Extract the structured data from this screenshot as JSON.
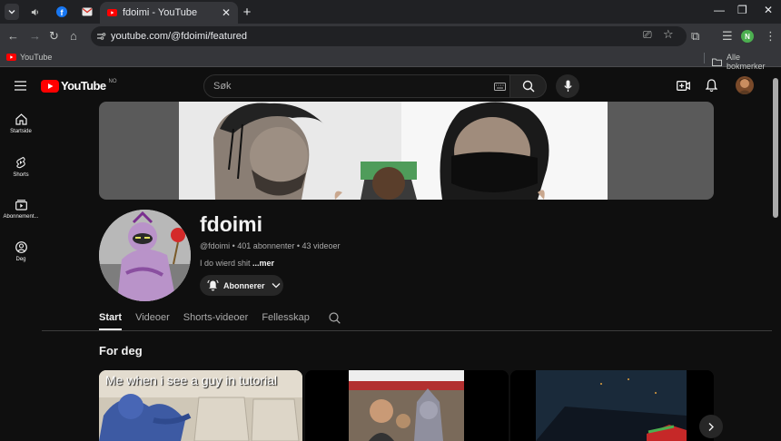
{
  "browser": {
    "active_tab_title": "fdoimi - YouTube",
    "url": "youtube.com/@fdoimi/featured",
    "bookmark_youtube": "YouTube",
    "bookmark_all": "Alle bokmerker",
    "profile_letter": "N"
  },
  "youtube": {
    "logo_text": "YouTube",
    "region": "NO",
    "search_placeholder": "Søk"
  },
  "sidebar": {
    "items": [
      {
        "label": "Startside",
        "icon": "home-icon"
      },
      {
        "label": "Shorts",
        "icon": "shorts-icon"
      },
      {
        "label": "Abonnement...",
        "icon": "subscriptions-icon"
      },
      {
        "label": "Deg",
        "icon": "user-icon"
      }
    ]
  },
  "channel": {
    "name": "fdoimi",
    "handle_line": "@fdoimi • 401 abonnenter • 43 videoer",
    "description": "I do wierd shit",
    "more": "...mer",
    "subscribe_label": "Abonnerer"
  },
  "tabs": [
    "Start",
    "Videoer",
    "Shorts-videoer",
    "Fellesskap"
  ],
  "section": {
    "title": "For deg",
    "first_video_caption": "Me when i see a guy in tutorial"
  },
  "colors": {
    "brand_red": "#ff0000",
    "bg": "#0f0f0f",
    "text": "#f1f1f1",
    "muted": "#aaaaaa"
  }
}
